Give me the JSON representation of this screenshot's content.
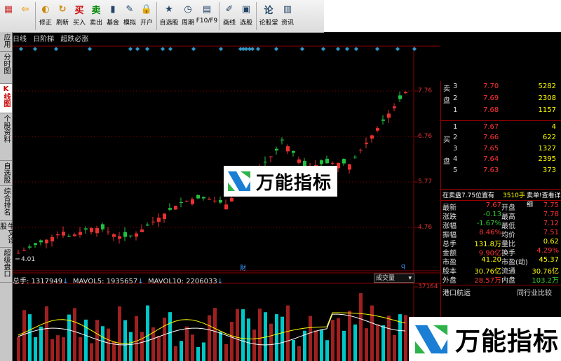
{
  "toolbar": {
    "buttons": [
      {
        "label": "",
        "icon": "grid-icon"
      },
      {
        "label": "",
        "icon": "back-arrow-icon"
      },
      {
        "label": "修正",
        "icon": "adjust-icon"
      },
      {
        "label": "刷新",
        "icon": "refresh-icon"
      },
      {
        "label": "买入",
        "icon": "buy-icon"
      },
      {
        "label": "卖出",
        "icon": "sell-icon"
      },
      {
        "label": "基金",
        "icon": "fund-icon"
      },
      {
        "label": "模拟",
        "icon": "simulate-icon"
      },
      {
        "label": "开户",
        "icon": "lock-icon"
      },
      {
        "label": "自选股",
        "icon": "watchlist-icon"
      },
      {
        "label": "周期",
        "icon": "clock-icon"
      },
      {
        "label": "F10/F9",
        "icon": "f10-icon"
      },
      {
        "label": "画线",
        "icon": "pencil-icon"
      },
      {
        "label": "选股",
        "icon": "screen-icon"
      },
      {
        "label": "论股堂",
        "icon": "forum-icon"
      },
      {
        "label": "资讯",
        "icon": "news-icon"
      }
    ]
  },
  "sidebar": {
    "items": [
      {
        "label": "应用"
      },
      {
        "label": "分时图"
      },
      {
        "label": "K线图"
      },
      {
        "label": "个股资料"
      },
      {
        "label": "自选股"
      },
      {
        "label": "综合排名"
      },
      {
        "label": "牛叉诊股"
      },
      {
        "label": "超级盘口"
      }
    ]
  },
  "chart_header": {
    "labels": [
      "日线",
      "日阶梯",
      "超跌必涨"
    ]
  },
  "price_axis": {
    "ticks": [
      "7.76",
      "6.76",
      "5.77",
      "4.76"
    ]
  },
  "low_marker": "4.01",
  "event_markers": [
    "财",
    "q"
  ],
  "volume": {
    "total_label": "总手: 1317949",
    "mavol5_label": "MAVOL5: 1935657",
    "mavol10_label": "MAVOL10: 2206033",
    "select_value": "成交量",
    "axis_tick": "37164"
  },
  "order_book": {
    "sell": [
      {
        "side": "卖",
        "level": "3",
        "price": "7.70",
        "vol": "5282"
      },
      {
        "side": "盘",
        "level": "2",
        "price": "7.69",
        "vol": "2308"
      },
      {
        "side": "",
        "level": "1",
        "price": "7.68",
        "vol": "1157"
      }
    ],
    "buy": [
      {
        "side": "",
        "level": "1",
        "price": "7.67",
        "vol": "4"
      },
      {
        "side": "买",
        "level": "2",
        "price": "7.66",
        "vol": "622"
      },
      {
        "side": "",
        "level": "3",
        "price": "7.65",
        "vol": "1327"
      },
      {
        "side": "盘",
        "level": "4",
        "price": "7.64",
        "vol": "2395"
      },
      {
        "side": "",
        "level": "5",
        "price": "7.63",
        "vol": "373"
      }
    ]
  },
  "queue_bar": {
    "left": "在卖盘7.75位置有",
    "mid": "3510手",
    "right": "卖单!查看详细"
  },
  "stats": [
    {
      "l1": "最新",
      "v1": "7.67",
      "l2": "开盘",
      "v2": "7.75"
    },
    {
      "l1": "涨跌",
      "v1": "-0.13",
      "l2": "最高",
      "v2": "7.78"
    },
    {
      "l1": "涨幅",
      "v1": "-1.67%",
      "l2": "最低",
      "v2": "7.12"
    },
    {
      "l1": "振幅",
      "v1": "8.46%",
      "l2": "均价",
      "v2": "7.51"
    },
    {
      "l1": "总手",
      "v1": "131.8万",
      "l2": "量比",
      "v2": "0.62"
    },
    {
      "l1": "金额",
      "v1": "9.90亿",
      "l2": "换手",
      "v2": "4.29%"
    },
    {
      "l1": "市盈",
      "v1": "41.20",
      "l2": "市盈(动)",
      "v2": "45.37"
    },
    {
      "l1": "股本",
      "v1": "30.76亿",
      "l2": "流通",
      "v2": "30.76亿"
    },
    {
      "l1": "外盘",
      "v1": "28.57万",
      "l2": "内盘",
      "v2": "103.2万"
    }
  ],
  "bottom_bar": {
    "left": "港口航运",
    "right": "同行业比较"
  },
  "watermark": {
    "text": "万能指标"
  },
  "colors": {
    "up": "#e02020",
    "down": "#00c8c8",
    "up_candle": "#e83030",
    "down_candle": "#20c040",
    "grid": "#8b0000",
    "ma_white": "#ffffff",
    "ma_yellow": "#ffff00"
  }
}
